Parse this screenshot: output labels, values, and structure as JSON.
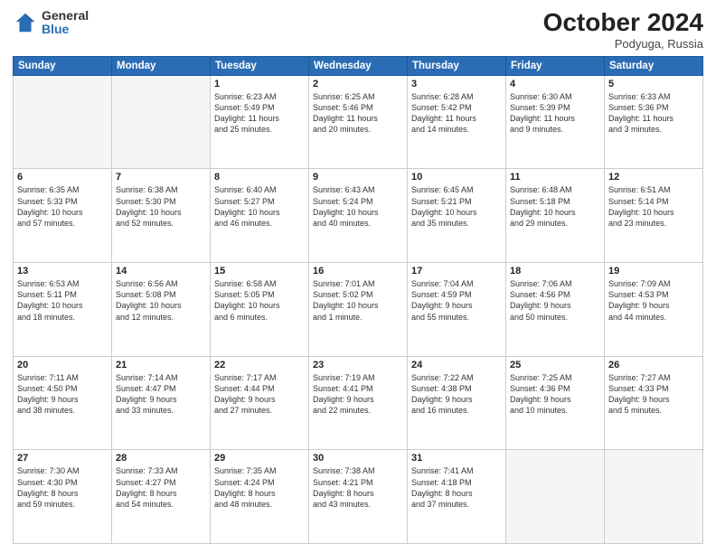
{
  "header": {
    "logo_general": "General",
    "logo_blue": "Blue",
    "title": "October 2024",
    "location": "Podyuga, Russia"
  },
  "weekdays": [
    "Sunday",
    "Monday",
    "Tuesday",
    "Wednesday",
    "Thursday",
    "Friday",
    "Saturday"
  ],
  "weeks": [
    [
      {
        "day": "",
        "info": ""
      },
      {
        "day": "",
        "info": ""
      },
      {
        "day": "1",
        "info": "Sunrise: 6:23 AM\nSunset: 5:49 PM\nDaylight: 11 hours\nand 25 minutes."
      },
      {
        "day": "2",
        "info": "Sunrise: 6:25 AM\nSunset: 5:46 PM\nDaylight: 11 hours\nand 20 minutes."
      },
      {
        "day": "3",
        "info": "Sunrise: 6:28 AM\nSunset: 5:42 PM\nDaylight: 11 hours\nand 14 minutes."
      },
      {
        "day": "4",
        "info": "Sunrise: 6:30 AM\nSunset: 5:39 PM\nDaylight: 11 hours\nand 9 minutes."
      },
      {
        "day": "5",
        "info": "Sunrise: 6:33 AM\nSunset: 5:36 PM\nDaylight: 11 hours\nand 3 minutes."
      }
    ],
    [
      {
        "day": "6",
        "info": "Sunrise: 6:35 AM\nSunset: 5:33 PM\nDaylight: 10 hours\nand 57 minutes."
      },
      {
        "day": "7",
        "info": "Sunrise: 6:38 AM\nSunset: 5:30 PM\nDaylight: 10 hours\nand 52 minutes."
      },
      {
        "day": "8",
        "info": "Sunrise: 6:40 AM\nSunset: 5:27 PM\nDaylight: 10 hours\nand 46 minutes."
      },
      {
        "day": "9",
        "info": "Sunrise: 6:43 AM\nSunset: 5:24 PM\nDaylight: 10 hours\nand 40 minutes."
      },
      {
        "day": "10",
        "info": "Sunrise: 6:45 AM\nSunset: 5:21 PM\nDaylight: 10 hours\nand 35 minutes."
      },
      {
        "day": "11",
        "info": "Sunrise: 6:48 AM\nSunset: 5:18 PM\nDaylight: 10 hours\nand 29 minutes."
      },
      {
        "day": "12",
        "info": "Sunrise: 6:51 AM\nSunset: 5:14 PM\nDaylight: 10 hours\nand 23 minutes."
      }
    ],
    [
      {
        "day": "13",
        "info": "Sunrise: 6:53 AM\nSunset: 5:11 PM\nDaylight: 10 hours\nand 18 minutes."
      },
      {
        "day": "14",
        "info": "Sunrise: 6:56 AM\nSunset: 5:08 PM\nDaylight: 10 hours\nand 12 minutes."
      },
      {
        "day": "15",
        "info": "Sunrise: 6:58 AM\nSunset: 5:05 PM\nDaylight: 10 hours\nand 6 minutes."
      },
      {
        "day": "16",
        "info": "Sunrise: 7:01 AM\nSunset: 5:02 PM\nDaylight: 10 hours\nand 1 minute."
      },
      {
        "day": "17",
        "info": "Sunrise: 7:04 AM\nSunset: 4:59 PM\nDaylight: 9 hours\nand 55 minutes."
      },
      {
        "day": "18",
        "info": "Sunrise: 7:06 AM\nSunset: 4:56 PM\nDaylight: 9 hours\nand 50 minutes."
      },
      {
        "day": "19",
        "info": "Sunrise: 7:09 AM\nSunset: 4:53 PM\nDaylight: 9 hours\nand 44 minutes."
      }
    ],
    [
      {
        "day": "20",
        "info": "Sunrise: 7:11 AM\nSunset: 4:50 PM\nDaylight: 9 hours\nand 38 minutes."
      },
      {
        "day": "21",
        "info": "Sunrise: 7:14 AM\nSunset: 4:47 PM\nDaylight: 9 hours\nand 33 minutes."
      },
      {
        "day": "22",
        "info": "Sunrise: 7:17 AM\nSunset: 4:44 PM\nDaylight: 9 hours\nand 27 minutes."
      },
      {
        "day": "23",
        "info": "Sunrise: 7:19 AM\nSunset: 4:41 PM\nDaylight: 9 hours\nand 22 minutes."
      },
      {
        "day": "24",
        "info": "Sunrise: 7:22 AM\nSunset: 4:38 PM\nDaylight: 9 hours\nand 16 minutes."
      },
      {
        "day": "25",
        "info": "Sunrise: 7:25 AM\nSunset: 4:36 PM\nDaylight: 9 hours\nand 10 minutes."
      },
      {
        "day": "26",
        "info": "Sunrise: 7:27 AM\nSunset: 4:33 PM\nDaylight: 9 hours\nand 5 minutes."
      }
    ],
    [
      {
        "day": "27",
        "info": "Sunrise: 7:30 AM\nSunset: 4:30 PM\nDaylight: 8 hours\nand 59 minutes."
      },
      {
        "day": "28",
        "info": "Sunrise: 7:33 AM\nSunset: 4:27 PM\nDaylight: 8 hours\nand 54 minutes."
      },
      {
        "day": "29",
        "info": "Sunrise: 7:35 AM\nSunset: 4:24 PM\nDaylight: 8 hours\nand 48 minutes."
      },
      {
        "day": "30",
        "info": "Sunrise: 7:38 AM\nSunset: 4:21 PM\nDaylight: 8 hours\nand 43 minutes."
      },
      {
        "day": "31",
        "info": "Sunrise: 7:41 AM\nSunset: 4:18 PM\nDaylight: 8 hours\nand 37 minutes."
      },
      {
        "day": "",
        "info": ""
      },
      {
        "day": "",
        "info": ""
      }
    ]
  ]
}
